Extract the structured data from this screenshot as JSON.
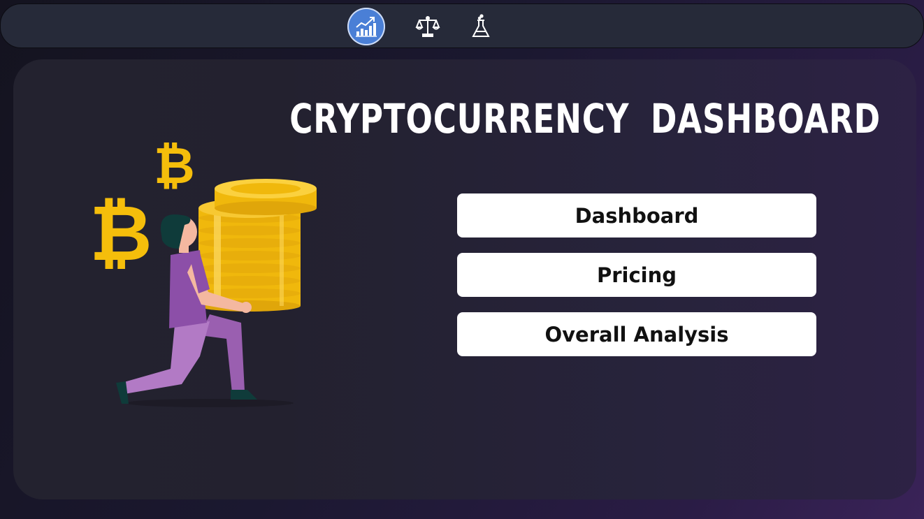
{
  "nav": {
    "items": [
      {
        "icon": "chart-growth-icon",
        "active": true
      },
      {
        "icon": "scales-icon",
        "active": false
      },
      {
        "icon": "flask-icon",
        "active": false
      }
    ],
    "active_color": "#4a7fd6"
  },
  "main": {
    "title": "CRYPTOCURRENCY DASHBOARD",
    "buttons": [
      {
        "label": "Dashboard"
      },
      {
        "label": "Pricing"
      },
      {
        "label": "Overall Analysis"
      }
    ]
  },
  "illustration": {
    "symbol": "₿",
    "coin_color": "#f5be0b",
    "icon": "person-carrying-coins-icon"
  }
}
